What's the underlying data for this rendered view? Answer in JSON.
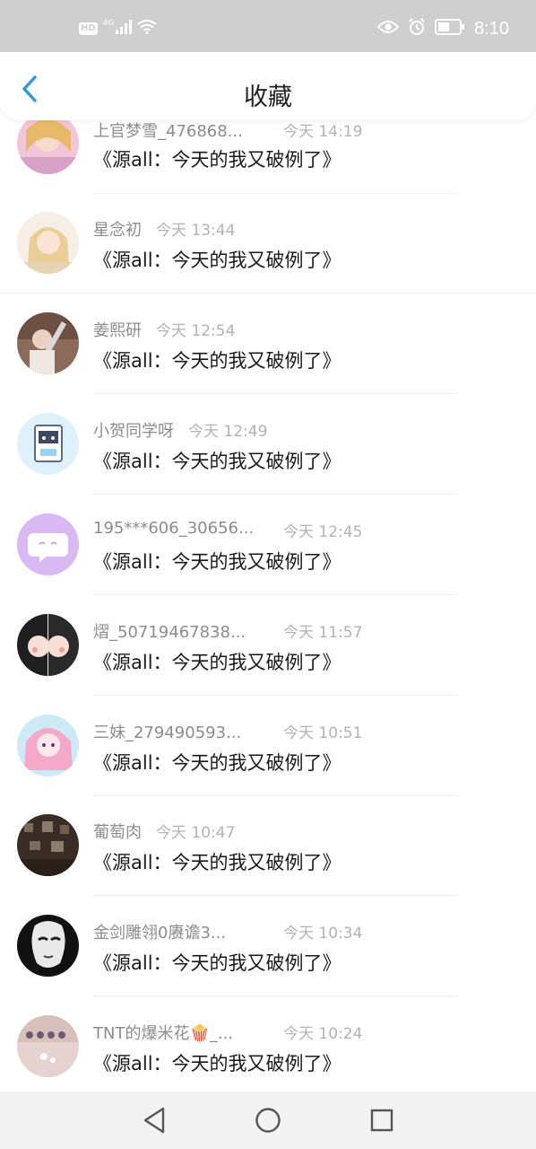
{
  "status_bar": {
    "hd": "HD",
    "network": "4G",
    "time": "8:10",
    "icons": [
      "signal-icon",
      "wifi-icon",
      "eye-icon",
      "alarm-icon",
      "battery-icon"
    ]
  },
  "header": {
    "title": "收藏",
    "back_icon": "chevron-left-icon",
    "accent": "#2d9cdb"
  },
  "messages": [
    {
      "name": "上官梦雪_476868...",
      "time": "今天 14:19",
      "text": "《源all：今天的我又破例了》"
    },
    {
      "name": "星念初",
      "time": "今天 13:44",
      "text": "《源all：今天的我又破例了》"
    },
    {
      "name": "姜熙研",
      "time": "今天 12:54",
      "text": "《源all：今天的我又破例了》"
    },
    {
      "name": "小贺同学呀",
      "time": "今天 12:49",
      "text": "《源all：今天的我又破例了》"
    },
    {
      "name": "195***606_30656...",
      "time": "今天 12:45",
      "text": "《源all：今天的我又破例了》"
    },
    {
      "name": "熠_50719467838...",
      "time": "今天 11:57",
      "text": "《源all：今天的我又破例了》"
    },
    {
      "name": "三妹_279490593...",
      "time": "今天 10:51",
      "text": "《源all：今天的我又破例了》"
    },
    {
      "name": "葡萄肉",
      "time": "今天 10:47",
      "text": "《源all：今天的我又破例了》"
    },
    {
      "name": "金剑雕翎0赓谵3...",
      "time": "今天 10:34",
      "text": "《源all：今天的我又破例了》"
    },
    {
      "name": "TNT的爆米花🍿_...",
      "time": "今天 10:24",
      "text": "《源all：今天的我又破例了》"
    }
  ],
  "nav_bar": {
    "icons": [
      "back-triangle-icon",
      "home-circle-icon",
      "recents-square-icon"
    ]
  }
}
